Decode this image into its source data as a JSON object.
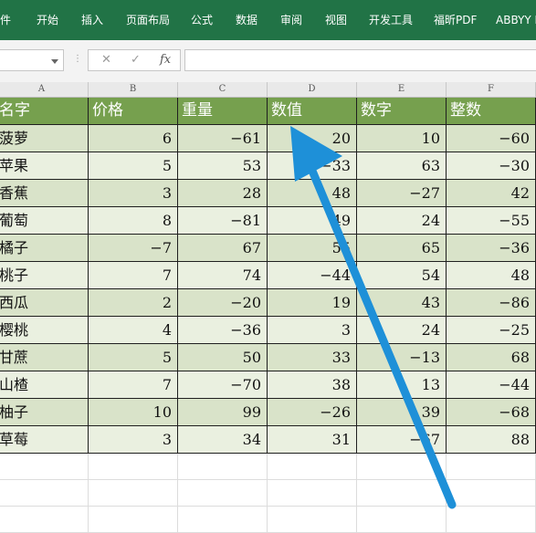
{
  "ribbon": {
    "tabs": [
      "件",
      "开始",
      "插入",
      "页面布局",
      "公式",
      "数据",
      "审阅",
      "视图",
      "开发工具",
      "福昕PDF",
      "ABBYY F"
    ]
  },
  "formula_bar": {
    "separator": "⋮",
    "cancel": "✕",
    "enter": "✓",
    "fx": "fx",
    "value": ""
  },
  "columns": [
    "A",
    "B",
    "C",
    "D",
    "E",
    "F"
  ],
  "headers": [
    "名字",
    "价格",
    "重量",
    "数值",
    "数字",
    "整数"
  ],
  "rows": [
    [
      "菠萝",
      "6",
      "-61",
      "20",
      "10",
      "-60"
    ],
    [
      "苹果",
      "5",
      "53",
      "-33",
      "63",
      "-30"
    ],
    [
      "香蕉",
      "3",
      "28",
      "48",
      "-27",
      "42"
    ],
    [
      "葡萄",
      "8",
      "-81",
      "49",
      "24",
      "-55"
    ],
    [
      "橘子",
      "-7",
      "67",
      "55",
      "65",
      "-36"
    ],
    [
      "桃子",
      "7",
      "74",
      "-44",
      "54",
      "48"
    ],
    [
      "西瓜",
      "2",
      "-20",
      "19",
      "43",
      "-86"
    ],
    [
      "樱桃",
      "4",
      "-36",
      "3",
      "24",
      "-25"
    ],
    [
      "甘蔗",
      "5",
      "50",
      "33",
      "-13",
      "68"
    ],
    [
      "山楂",
      "7",
      "-70",
      "38",
      "13",
      "-44"
    ],
    [
      "柚子",
      "10",
      "99",
      "-26",
      "39",
      "-68"
    ],
    [
      "草莓",
      "3",
      "34",
      "31",
      "-67",
      "88"
    ]
  ],
  "colors": {
    "ribbon": "#217346",
    "header_fill": "#76a04e",
    "row_odd": "#d9e3c9",
    "row_even": "#eaf0e0",
    "arrow": "#1e90d8"
  },
  "overlay": {
    "icon": "blue-arrow-annotation"
  }
}
